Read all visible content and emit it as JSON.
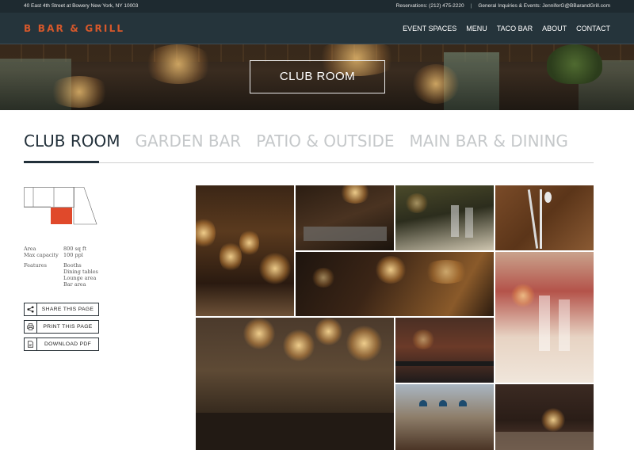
{
  "topbar": {
    "address": "40 East 4th Street at Bowery New York, NY 10003",
    "reservations": "Reservations: (212) 475-2220",
    "separator": "|",
    "inquiries": "General Inquiries & Events: JenniferG@BBarandGrill.com"
  },
  "nav": {
    "logo": "B BAR & GRILL",
    "menu": [
      "EVENT SPACES",
      "MENU",
      "TACO BAR",
      "ABOUT",
      "CONTACT"
    ]
  },
  "hero": {
    "title": "CLUB ROOM"
  },
  "tabs": [
    "CLUB ROOM",
    "GARDEN BAR",
    "PATIO & OUTSIDE",
    "MAIN BAR & DINING"
  ],
  "details": {
    "area_label": "Area",
    "area_value": "800 sq ft",
    "capacity_label": "Max capacity",
    "capacity_value": "100 ppl",
    "features_label": "Features",
    "features": [
      "Booths",
      "Dining tables",
      "Lounge area",
      "Bar area"
    ]
  },
  "actions": {
    "share": "SHARE THIS PAGE",
    "print": "PRINT THIS PAGE",
    "download": "DOWNLOAD PDF"
  },
  "icons": {
    "share": "share-icon",
    "print": "print-icon",
    "download": "pdf-icon"
  },
  "colors": {
    "brand": "#d6582b",
    "nav_bg": "#25343b",
    "active_tab": "#22303a",
    "plan_highlight": "#e0492b"
  }
}
